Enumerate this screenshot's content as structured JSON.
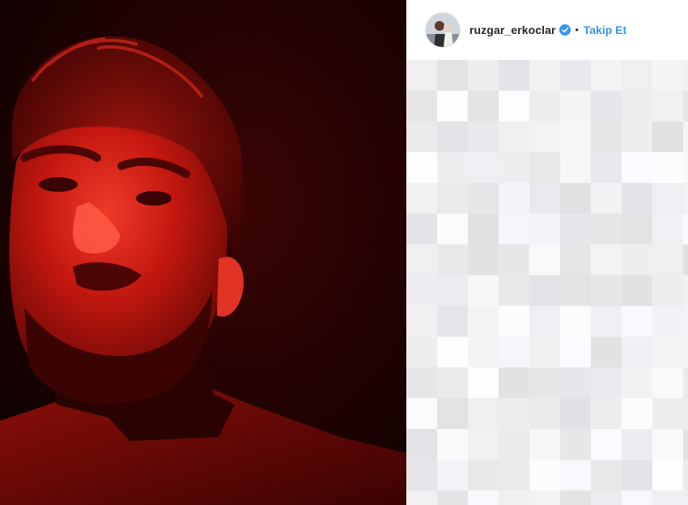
{
  "post": {
    "author": {
      "username": "ruzgar_erkoclar",
      "verified": true,
      "avatar_icon": "avatar-photo"
    },
    "separator": "•",
    "follow_label": "Takip Et",
    "media_icon": "portrait-photo-red-light",
    "comments_censored": true
  },
  "colors": {
    "link_blue": "#3897f0",
    "verified_blue": "#3897f0",
    "photo_red": "#c0211c",
    "text_dark": "#262626"
  }
}
